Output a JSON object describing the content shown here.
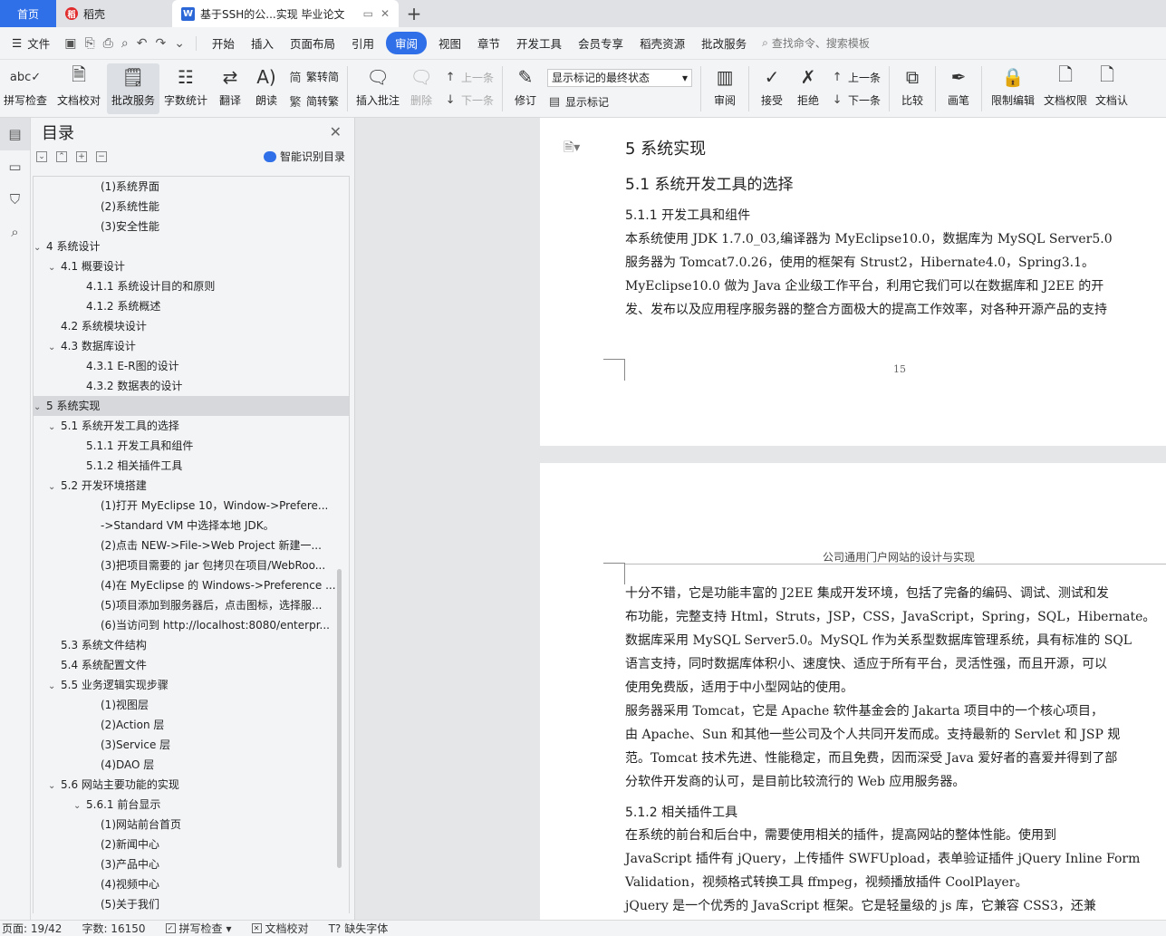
{
  "tabs": {
    "home": "首页",
    "shell": "稻壳",
    "active": "基于SSH的公...实现 毕业论文"
  },
  "menu": {
    "file": "文件",
    "items": [
      "开始",
      "插入",
      "页面布局",
      "引用",
      "审阅",
      "视图",
      "章节",
      "开发工具",
      "会员专享",
      "稻壳资源",
      "批改服务"
    ],
    "active": "审阅",
    "search": "查找命令、搜索模板"
  },
  "ribbon": {
    "spell": "拼写检查",
    "proofread": "文档校对",
    "correct_service": "批改服务",
    "word_count": "字数统计",
    "translate": "翻译",
    "read_aloud": "朗读",
    "to_traditional": "繁转简",
    "to_simplified": "简转繁",
    "insert_comment": "插入批注",
    "delete": "删除",
    "prev": "上一条",
    "next": "下一条",
    "track": "修订",
    "markup_select": "显示标记的最终状态",
    "show_markup": "显示标记",
    "review": "审阅",
    "accept": "接受",
    "reject": "拒绝",
    "prev2": "上一条",
    "next2": "下一条",
    "compare": "比较",
    "ink": "画笔",
    "restrict": "限制编辑",
    "permission": "文档权限",
    "certify": "文档认证"
  },
  "toc": {
    "title": "目录",
    "smart": "智能识别目录",
    "items": [
      {
        "t": "(1)系统界面",
        "lv": 4,
        "car": ""
      },
      {
        "t": "(2)系统性能",
        "lv": 4,
        "car": ""
      },
      {
        "t": "(3)安全性能",
        "lv": 4,
        "car": ""
      },
      {
        "t": "4  系统设计",
        "lv": 1,
        "car": "v"
      },
      {
        "t": "4.1  概要设计",
        "lv": 2,
        "car": "v"
      },
      {
        "t": "4.1.1  系统设计目的和原则",
        "lv": 3,
        "car": ""
      },
      {
        "t": "4.1.2  系统概述",
        "lv": 3,
        "car": ""
      },
      {
        "t": "4.2  系统模块设计",
        "lv": 2,
        "car": ""
      },
      {
        "t": "4.3  数据库设计",
        "lv": 2,
        "car": "v"
      },
      {
        "t": "4.3.1  E-R图的设计",
        "lv": 3,
        "car": ""
      },
      {
        "t": "4.3.2  数据表的设计",
        "lv": 3,
        "car": ""
      },
      {
        "t": "5  系统实现",
        "lv": 1,
        "car": "v",
        "sel": true
      },
      {
        "t": "5.1  系统开发工具的选择",
        "lv": 2,
        "car": "v"
      },
      {
        "t": "5.1.1  开发工具和组件",
        "lv": 3,
        "car": ""
      },
      {
        "t": "5.1.2  相关插件工具",
        "lv": 3,
        "car": ""
      },
      {
        "t": "5.2  开发环境搭建",
        "lv": 2,
        "car": "v"
      },
      {
        "t": "(1)打开 MyEclipse 10，Window->Prefere...",
        "lv": 4,
        "car": ""
      },
      {
        "t": "->Standard VM 中选择本地 JDK。",
        "lv": 4,
        "car": ""
      },
      {
        "t": "(2)点击 NEW->File->Web Project 新建一...",
        "lv": 4,
        "car": ""
      },
      {
        "t": "(3)把项目需要的 jar 包拷贝在项目/WebRoo...",
        "lv": 4,
        "car": ""
      },
      {
        "t": "(4)在 MyEclipse 的 Windows->Preference ...",
        "lv": 4,
        "car": ""
      },
      {
        "t": "(5)项目添加到服务器后，点击图标，选择服...",
        "lv": 4,
        "car": ""
      },
      {
        "t": "(6)当访问到 http://localhost:8080/enterpr...",
        "lv": 4,
        "car": ""
      },
      {
        "t": "5.3  系统文件结构",
        "lv": 2,
        "car": ""
      },
      {
        "t": "5.4  系统配置文件",
        "lv": 2,
        "car": ""
      },
      {
        "t": "5.5  业务逻辑实现步骤",
        "lv": 2,
        "car": "v"
      },
      {
        "t": "(1)视图层",
        "lv": 4,
        "car": ""
      },
      {
        "t": "(2)Action 层",
        "lv": 4,
        "car": ""
      },
      {
        "t": "(3)Service 层",
        "lv": 4,
        "car": ""
      },
      {
        "t": "(4)DAO 层",
        "lv": 4,
        "car": ""
      },
      {
        "t": "5.6  网站主要功能的实现",
        "lv": 2,
        "car": "v"
      },
      {
        "t": "5.6.1  前台显示",
        "lv": 3,
        "car": "v"
      },
      {
        "t": "(1)网站前台首页",
        "lv": 4,
        "car": ""
      },
      {
        "t": "(2)新闻中心",
        "lv": 4,
        "car": ""
      },
      {
        "t": "(3)产品中心",
        "lv": 4,
        "car": ""
      },
      {
        "t": "(4)视频中心",
        "lv": 4,
        "car": ""
      },
      {
        "t": "(5)关于我们",
        "lv": 4,
        "car": ""
      }
    ]
  },
  "doc": {
    "page1": {
      "h1": "5   系统实现",
      "h2": "5.1   系统开发工具的选择",
      "h3": "5.1.1   开发工具和组件",
      "lines": [
        "    本系统使用 JDK 1.7.0_03,编译器为 MyEclipse10.0，数据库为 MySQL Server5.0",
        "服务器为 Tomcat7.0.26，使用的框架有 Strust2，Hibernate4.0，Spring3.1。",
        "    MyEclipse10.0 做为 Java 企业级工作平台，利用它我们可以在数据库和 J2EE 的开",
        "发、发布以及应用程序服务器的整合方面极大的提高工作效率，对各种开源产品的支持"
      ],
      "page_number": "15"
    },
    "page2": {
      "header": "公司通用门户网站的设计与实现",
      "lines_a": [
        "十分不错，它是功能丰富的 J2EE 集成开发环境，包括了完备的编码、调试、测试和发",
        "布功能，完整支持 Html，Struts，JSP，CSS，JavaScript，Spring，SQL，Hibernate。",
        "    数据库采用 MySQL Server5.0。MySQL 作为关系型数据库管理系统，具有标准的 SQL",
        "语言支持，同时数据库体积小、速度快、适应于所有平台，灵活性强，而且开源，可以",
        "使用免费版，适用于中小型网站的使用。",
        "    服务器采用 Tomcat，它是 Apache 软件基金会的 Jakarta 项目中的一个核心项目，",
        "由 Apache、Sun 和其他一些公司及个人共同开发而成。支持最新的 Servlet 和 JSP 规",
        "范。Tomcat 技术先进、性能稳定，而且免费，因而深受 Java 爱好者的喜爱并得到了部",
        "分软件开发商的认可，是目前比较流行的 Web 应用服务器。"
      ],
      "h3": "5.1.2   相关插件工具",
      "lines_b": [
        "    在系统的前台和后台中，需要使用相关的插件，提高网站的整体性能。使用到",
        "JavaScript 插件有 jQuery，上传插件 SWFUpload，表单验证插件 jQuery Inline Form",
        "Validation，视频格式转换工具 ffmpeg，视频播放插件 CoolPlayer。",
        "    jQuery 是一个优秀的 JavaScript 框架。它是轻量级的 js 库，它兼容 CSS3，还兼"
      ]
    }
  },
  "status": {
    "page": "页面: 19/42",
    "words": "字数: 16150",
    "spell": "拼写检查",
    "proof": "文档校对",
    "missing_font": "缺失字体"
  }
}
